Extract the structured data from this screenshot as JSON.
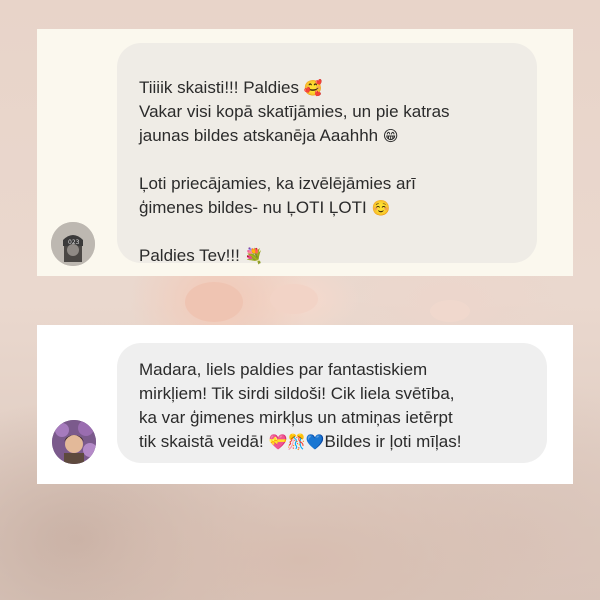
{
  "comments": [
    {
      "lines": [
        "Tiiiik skaisti!!! Paldies",
        "Vakar visi kopā skatījāmies, un pie katras",
        "jaunas bildes atskanēja Aaahhh",
        "",
        "Ļoti priecājamies, ka izvēlējāmies arī",
        "ģimenes bildes- nu ĻOTI ĻOTI",
        "",
        "Paldies Tev!!!"
      ],
      "emojis": {
        "l0": "🥰",
        "l2": "😁",
        "l5": "☺️",
        "l7": "💐"
      }
    },
    {
      "lines": [
        "Madara, liels paldies par fantastiskiem",
        "mirkļiem! Tik sirdi sildoši! Cik liela svētība,",
        "ka var ģimenes mirkļus un atmiņas ietērpt",
        "tik skaistā veidā!",
        "Bildes ir ļoti mīļas!"
      ],
      "emojis": {
        "l3": "💝🎊💙"
      }
    }
  ],
  "colors": {
    "card1_bg": "#fbf8ee",
    "card2_bg": "#ffffff",
    "bubble1_bg": "#efece6",
    "bubble2_bg": "#efefef"
  }
}
